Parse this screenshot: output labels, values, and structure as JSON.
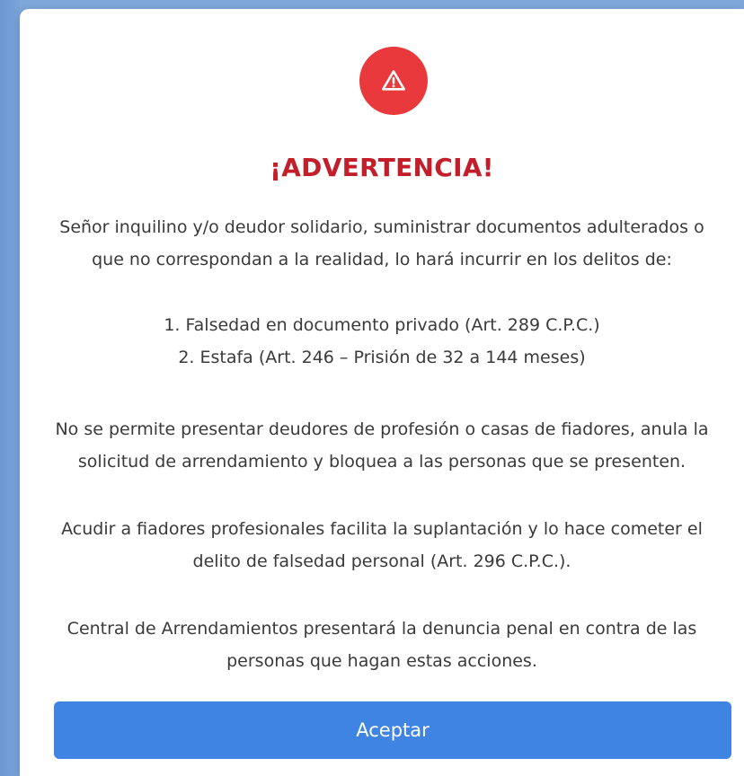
{
  "dialog": {
    "icon": "warning-triangle-icon",
    "title": "¡ADVERTENCIA!",
    "paragraph1": "Señor inquilino y/o deudor solidario, suministrar documentos adulterados o que no correspondan a la realidad, lo hará incurrir en los delitos de:",
    "crimes": [
      "1. Falsedad en documento privado (Art. 289 C.P.C.)",
      "2. Estafa (Art. 246 – Prisión de 32 a 144 meses)"
    ],
    "paragraph2": "No se permite presentar deudores de profesión o casas de fiadores, anula la solicitud de arrendamiento y bloquea a las personas que se presenten.",
    "paragraph3": "Acudir a fiadores profesionales facilita la suplantación y lo hace cometer el delito de falsedad personal (Art. 296 C.P.C.).",
    "paragraph4": "Central de Arrendamientos presentará la denuncia penal en contra de las personas que hagan estas acciones.",
    "accept_label": "Aceptar"
  },
  "colors": {
    "warning_red": "#e9393c",
    "title_red": "#c31f2b",
    "button_blue": "#3f84e3",
    "backdrop_blue": "#6f9bd4"
  }
}
